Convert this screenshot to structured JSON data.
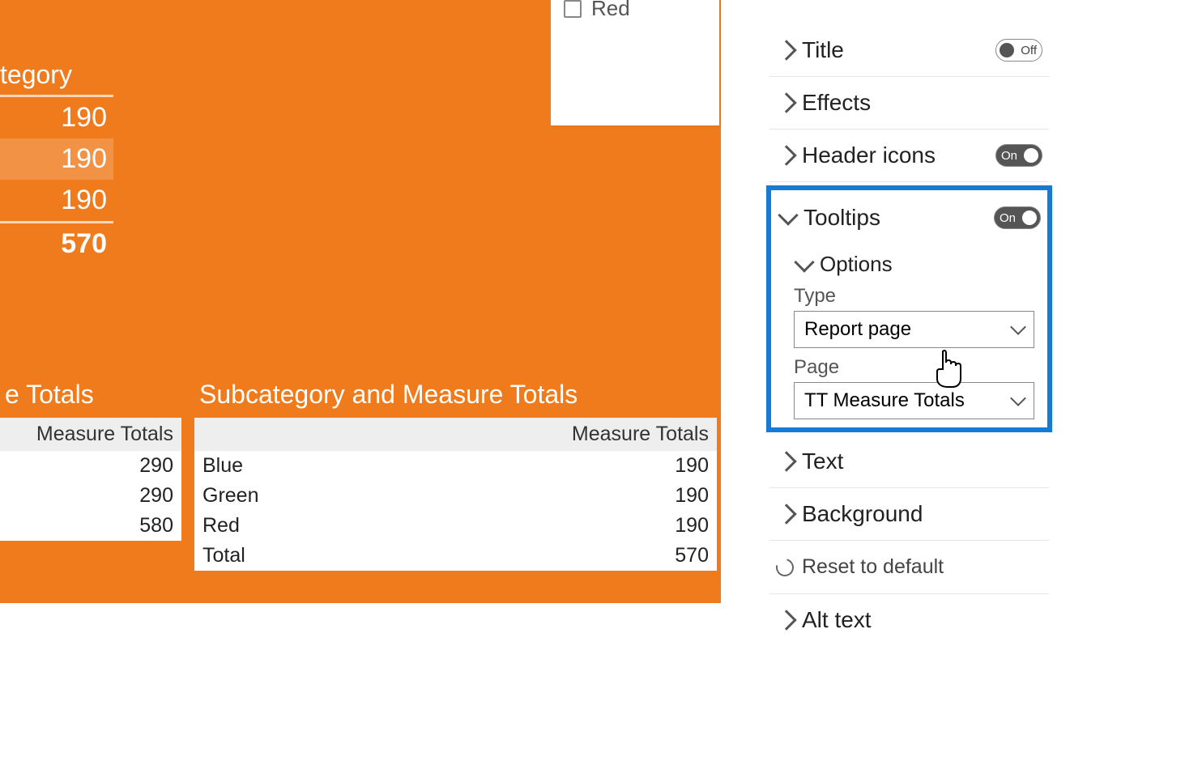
{
  "slicer": {
    "red_label": "Red"
  },
  "top_table": {
    "header": "tegory",
    "rows": [
      "190",
      "190",
      "190"
    ],
    "total": "570"
  },
  "left_table": {
    "title": "e Totals",
    "col_header": "Measure Totals",
    "rows": [
      {
        "val": "290"
      },
      {
        "val": "290"
      },
      {
        "val": "580"
      }
    ]
  },
  "right_table": {
    "title": "Subcategory and Measure Totals",
    "col_header": "Measure Totals",
    "rows": [
      {
        "cat": "Blue",
        "val": "190"
      },
      {
        "cat": "Green",
        "val": "190"
      },
      {
        "cat": "Red",
        "val": "190"
      },
      {
        "cat": "Total",
        "val": "570"
      }
    ]
  },
  "pane": {
    "title": {
      "label": "Title",
      "state": "Off"
    },
    "effects": {
      "label": "Effects"
    },
    "headericons": {
      "label": "Header icons",
      "state": "On"
    },
    "tooltips": {
      "label": "Tooltips",
      "state": "On"
    },
    "options": {
      "label": "Options"
    },
    "type_label": "Type",
    "type_value": "Report page",
    "page_label": "Page",
    "page_value": "TT Measure Totals",
    "text": {
      "label": "Text"
    },
    "background": {
      "label": "Background"
    },
    "reset": "Reset to default",
    "alttext": {
      "label": "Alt text"
    }
  }
}
